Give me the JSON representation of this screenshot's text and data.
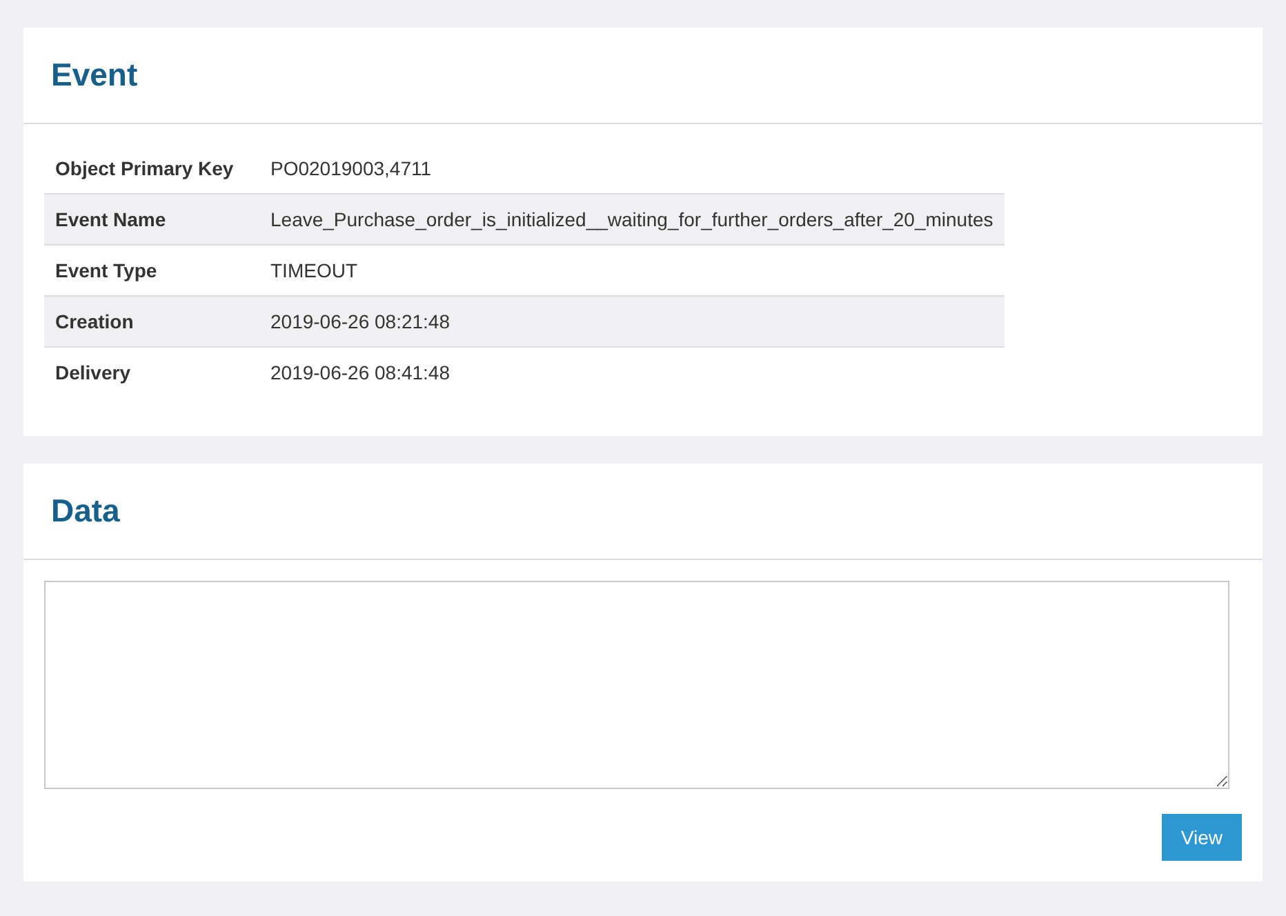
{
  "event": {
    "title": "Event",
    "rows": [
      {
        "label": "Object Primary Key",
        "value": "PO02019003,4711"
      },
      {
        "label": "Event Name",
        "value": "Leave_Purchase_order_is_initialized__waiting_for_further_orders_after_20_minutes"
      },
      {
        "label": "Event Type",
        "value": "TIMEOUT"
      },
      {
        "label": "Creation",
        "value": "2019-06-26 08:21:48"
      },
      {
        "label": "Delivery",
        "value": "2019-06-26 08:41:48"
      }
    ]
  },
  "data": {
    "title": "Data",
    "button": "View"
  }
}
